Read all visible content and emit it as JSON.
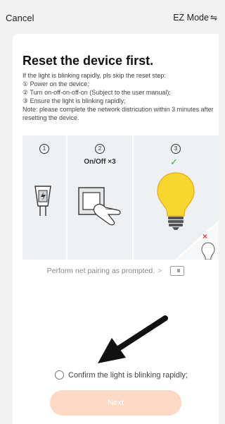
{
  "header": {
    "cancel_label": "Cancel",
    "mode_label": "EZ Mode",
    "mode_icon": "swap-icon"
  },
  "main": {
    "title": "Reset the device first.",
    "intro": "If the light is blinking rapidly, pls skip the reset step:",
    "steps": [
      {
        "num": "①",
        "text": "Power on the device;"
      },
      {
        "num": "②",
        "text": "Turn on-off-on-off-on (Subject to the user manual);"
      },
      {
        "num": "③",
        "text": "Ensure the light is blinking rapidly;"
      }
    ],
    "note": "Note: please complete the network districution within 3 minutes after resetting the device.",
    "illustration": {
      "panels": [
        {
          "num": "1",
          "icon": "power-plug-icon"
        },
        {
          "num": "2",
          "caption": "On/Off ×3",
          "icon": "light-switch-icon"
        },
        {
          "num": "3",
          "icon": "light-bulb-icon",
          "status_ok": "✓",
          "status_bad": "×"
        }
      ]
    },
    "pairing_link": "Perform net pairing as prompted.",
    "pairing_chevron": ">",
    "confirm_label": "Confirm the light is blinking rapidly;",
    "next_label": "Next"
  },
  "colors": {
    "accent": "#fbd9c6",
    "ok": "#22b04b",
    "error": "#e0433c",
    "panel_bg": "#eef1f3"
  }
}
